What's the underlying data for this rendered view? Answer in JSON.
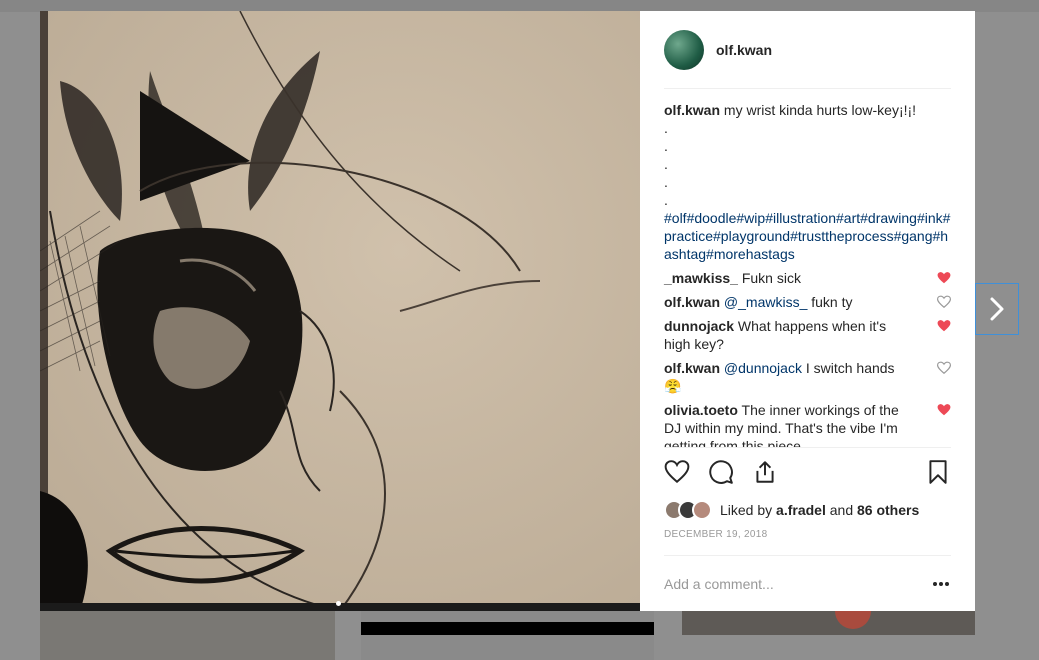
{
  "post": {
    "username": "olf.kwan",
    "caption_user": "olf.kwan",
    "caption_text": "my wrist kinda hurts low-key¡!¡!",
    "caption_dots": [
      ".",
      ".",
      ".",
      ".",
      "."
    ],
    "hashtags": "#olf#doodle#wip#illustration#art#drawing#ink#practice#playground#trusttheprocess#gang#hashtag#morehastags"
  },
  "comments": [
    {
      "user": "_mawkiss_",
      "mention": "",
      "text": "Fukn sick",
      "liked": true
    },
    {
      "user": "olf.kwan",
      "mention": "@_mawkiss_",
      "text": "fukn ty",
      "liked": false
    },
    {
      "user": "dunnojack",
      "mention": "",
      "text": "What happens when it's high key?",
      "liked": true
    },
    {
      "user": "olf.kwan",
      "mention": "@dunnojack",
      "text": "I switch hands 😤",
      "liked": false
    },
    {
      "user": "olivia.toeto",
      "mention": "",
      "text": "The inner workings of the DJ within my mind. That's the vibe I'm getting from this piece",
      "liked": true
    }
  ],
  "likes": {
    "prefix": "Liked by",
    "user": "a.fradel",
    "joiner": "and",
    "others": "86 others"
  },
  "date": "DECEMBER 19, 2018",
  "add_comment": {
    "placeholder": "Add a comment..."
  },
  "more_label": "•••",
  "colors": {
    "heart_red": "#ed4956",
    "link_blue": "#003569",
    "selection_blue": "#3f90d9"
  },
  "icons": [
    "heart-icon",
    "comment-icon",
    "share-icon",
    "bookmark-icon",
    "chevron-right-icon",
    "more-icon"
  ]
}
